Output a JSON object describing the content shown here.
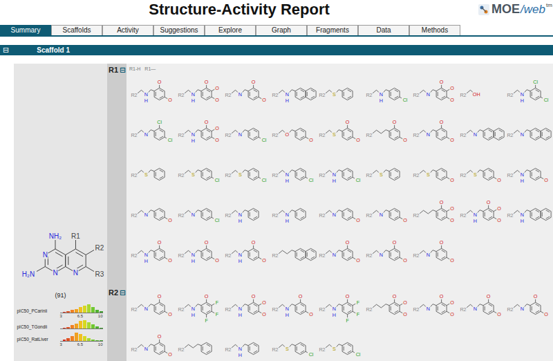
{
  "window": {
    "title": "Structure-Activity Report"
  },
  "logo": {
    "name": "MOE",
    "suffix": "/web",
    "tm": "tm"
  },
  "tabs": [
    {
      "label": "Summary",
      "selected": true
    },
    {
      "label": "Scaffolds",
      "selected": false
    },
    {
      "label": "Activity",
      "selected": false
    },
    {
      "label": "Suggestions",
      "selected": false
    },
    {
      "label": "Explore",
      "selected": false
    },
    {
      "label": "Graph",
      "selected": false
    },
    {
      "label": "Fragments",
      "selected": false
    },
    {
      "label": "Data",
      "selected": false
    },
    {
      "label": "Methods",
      "selected": false
    }
  ],
  "scaffold_bar": {
    "toggle": "⊟",
    "title": "Scaffold 1",
    "expanded": true
  },
  "scaffold": {
    "labels": {
      "c4": "NH₂",
      "r1": "R1",
      "r2": "R2",
      "n3": "N",
      "c2": "H₂N",
      "n1": "N",
      "n8": "N",
      "r3": "R3"
    },
    "count": "(91)"
  },
  "histograms": [
    {
      "label": "pIC50_PCarinii",
      "ticks": [
        "3",
        "6.5",
        "10"
      ],
      "bins": [
        {
          "level": 0.1,
          "color": "#d83020"
        },
        {
          "level": 0.15,
          "color": "#e05020"
        },
        {
          "level": 0.3,
          "color": "#f08020"
        },
        {
          "level": 0.45,
          "color": "#f0a020"
        },
        {
          "level": 0.65,
          "color": "#f0c020"
        },
        {
          "level": 0.85,
          "color": "#d8d820"
        },
        {
          "level": 1,
          "color": "#a8d830"
        },
        {
          "level": 0.7,
          "color": "#70c830"
        },
        {
          "level": 0.35,
          "color": "#50b030"
        },
        {
          "level": 0.15,
          "color": "#40a030"
        }
      ]
    },
    {
      "label": "pIC50_TGondii",
      "ticks": [],
      "bins": [
        {
          "level": 0.1,
          "color": "#d83020"
        },
        {
          "level": 0.2,
          "color": "#e05020"
        },
        {
          "level": 0.4,
          "color": "#f08020"
        },
        {
          "level": 0.6,
          "color": "#f0a020"
        },
        {
          "level": 0.9,
          "color": "#f0c020"
        },
        {
          "level": 1,
          "color": "#d8d820"
        },
        {
          "level": 0.75,
          "color": "#a8d830"
        },
        {
          "level": 0.5,
          "color": "#70c830"
        },
        {
          "level": 0.25,
          "color": "#50b030"
        },
        {
          "level": 0.1,
          "color": "#40a030"
        }
      ]
    },
    {
      "label": "pIC50_RatLiver",
      "ticks": [
        "3",
        "6.5",
        "10"
      ],
      "bins": [
        {
          "level": 0.15,
          "color": "#d83020"
        },
        {
          "level": 0.35,
          "color": "#e05020"
        },
        {
          "level": 0.6,
          "color": "#f08020"
        },
        {
          "level": 1,
          "color": "#f0a020"
        },
        {
          "level": 0.8,
          "color": "#f0c020"
        },
        {
          "level": 0.55,
          "color": "#d8d820"
        },
        {
          "level": 0.35,
          "color": "#a8d830"
        },
        {
          "level": 0.2,
          "color": "#70c830"
        },
        {
          "level": 0.1,
          "color": "#50b030"
        },
        {
          "level": 0.05,
          "color": "#40a030"
        }
      ]
    }
  ],
  "element_colors": {
    "R2": "#8a8a8a",
    "N": "#2a2adc",
    "H": "#2a2adc",
    "O": "#d02020",
    "OH": "#d02020",
    "S": "#b09a00",
    "Cl": "#1f9f1f",
    "F": "#1f9f1f"
  },
  "sections": [
    {
      "label": "R1",
      "toggle": "⊟",
      "expanded": true,
      "header": [
        "R1-H",
        "R1—"
      ],
      "attach_label": "R2",
      "fragments": [
        {
          "link": [
            "N",
            "H"
          ],
          "ring": "benzene",
          "subs": [
            "O",
            "O"
          ]
        },
        {
          "link": [
            "N",
            "H"
          ],
          "ring": "benzene",
          "subs": [
            "O",
            "O",
            "O"
          ]
        },
        {
          "link": [
            "N"
          ],
          "ring": "benzene",
          "subs": [
            "O",
            "O"
          ]
        },
        {
          "link": [
            "N",
            "H"
          ],
          "ring": "fused",
          "subs": []
        },
        {
          "link": [
            "S"
          ],
          "ring": "benzene",
          "subs": []
        },
        {
          "link": [
            "N",
            "H"
          ],
          "ring": "benzene",
          "subs": [
            "Cl"
          ]
        },
        {
          "link": [
            "N"
          ],
          "ring": "benzene",
          "subs": [
            "O",
            "O",
            "O"
          ]
        },
        {
          "link": [
            "OH"
          ],
          "ring": "none",
          "subs": []
        },
        {
          "link": [
            "N",
            "H"
          ],
          "ring": "benzene",
          "subs": [
            "Cl",
            "Cl"
          ]
        },
        {
          "link": [
            "N"
          ],
          "ring": "benzene",
          "subs": [
            "Cl",
            "Cl"
          ]
        },
        {
          "link": [
            "N",
            "H"
          ],
          "ring": "benzene",
          "subs": [
            "O",
            "O",
            "O"
          ]
        },
        {
          "link": [
            "N"
          ],
          "ring": "benzene",
          "subs": [
            "Cl"
          ]
        },
        {
          "link": [
            "O"
          ],
          "ring": "benzene",
          "subs": [
            "O"
          ]
        },
        {
          "link": [
            "S"
          ],
          "ring": "benzene",
          "subs": [
            "O",
            "O"
          ]
        },
        {
          "link": [],
          "ring": "benzene",
          "subs": [
            "O",
            "O"
          ]
        },
        {
          "link": [
            "N"
          ],
          "ring": "benzene",
          "subs": [
            "O",
            "O"
          ]
        },
        {
          "link": [
            "N"
          ],
          "ring": "fused",
          "subs": []
        },
        {
          "link": [
            "N"
          ],
          "ring": "fused",
          "subs": []
        },
        {
          "link": [
            "S"
          ],
          "ring": "benzene",
          "subs": []
        },
        {
          "link": [
            "S"
          ],
          "ring": "benzene",
          "subs": [
            "Cl"
          ]
        },
        {
          "link": [
            "S"
          ],
          "ring": "benzene",
          "subs": [
            "Cl"
          ]
        },
        {
          "link": [
            "N",
            "H"
          ],
          "ring": "benzene",
          "subs": [
            "Cl"
          ]
        },
        {
          "link": [
            "N",
            "H"
          ],
          "ring": "benzene",
          "subs": [
            "Cl"
          ]
        },
        {
          "link": [
            "S"
          ],
          "ring": "benzene",
          "subs": []
        },
        {
          "link": [
            "S"
          ],
          "ring": "benzene",
          "subs": [
            "O"
          ]
        },
        {
          "link": [
            "S"
          ],
          "ring": "benzene",
          "subs": [
            "O"
          ]
        },
        {
          "link": [
            "N",
            "H"
          ],
          "ring": "benzene",
          "subs": [
            "O"
          ]
        },
        {
          "link": [
            "N"
          ],
          "ring": "benzene",
          "subs": [
            "O"
          ]
        },
        {
          "link": [
            "N"
          ],
          "ring": "benzene",
          "subs": [
            "Cl"
          ]
        },
        {
          "link": [
            "N",
            "H"
          ],
          "ring": "benzene",
          "subs": []
        },
        {
          "link": [
            "N",
            "H"
          ],
          "ring": "benzene",
          "subs": []
        },
        {
          "link": [
            "N"
          ],
          "ring": "benzene",
          "subs": [
            "O"
          ]
        },
        {
          "link": [
            "N"
          ],
          "ring": "benzene",
          "subs": [
            "O"
          ]
        },
        {
          "link": [],
          "ring": "benzene",
          "subs": [
            "O",
            "O",
            "O"
          ]
        },
        {
          "link": [
            "N",
            "H"
          ],
          "ring": "benzene",
          "subs": [
            "O",
            "O",
            "O"
          ]
        },
        {
          "link": [
            "N",
            "H"
          ],
          "ring": "fused",
          "subs": []
        },
        {
          "link": [
            "N",
            "H"
          ],
          "ring": "benzene",
          "subs": [
            "O",
            "O"
          ]
        },
        {
          "link": [
            "N",
            "H"
          ],
          "ring": "benzene",
          "subs": [
            "O",
            "O"
          ]
        },
        {
          "link": [
            "N",
            "H"
          ],
          "ring": "benzene",
          "subs": [
            "O",
            "O"
          ]
        },
        {
          "link": [],
          "ring": "fused",
          "subs": []
        },
        {
          "link": [
            "N"
          ],
          "ring": "benzene",
          "subs": [
            "O",
            "O"
          ]
        },
        {
          "link": [
            "N"
          ],
          "ring": "benzene",
          "subs": [
            "O",
            "O"
          ]
        },
        {
          "link": [
            "N"
          ],
          "ring": "benzene",
          "subs": [
            "O",
            "O"
          ]
        }
      ]
    },
    {
      "label": "R2",
      "toggle": "⊟",
      "expanded": true,
      "header": [],
      "attach_label": "R2",
      "fragments": [
        {
          "link": [
            "N"
          ],
          "ring": "benzene",
          "subs": [
            "O",
            "O"
          ]
        },
        {
          "link": [
            "N",
            "H"
          ],
          "ring": "benzene",
          "subs": [
            "O",
            "F",
            "F",
            "F"
          ]
        },
        {
          "link": [
            "N",
            "H"
          ],
          "ring": "benzene",
          "subs": [
            "O",
            "O",
            "O"
          ]
        },
        {
          "link": [
            "N",
            "H"
          ],
          "ring": "benzene",
          "subs": [
            "O",
            "O"
          ]
        },
        {
          "link": [
            "N",
            "H"
          ],
          "ring": "benzene",
          "subs": [
            "O",
            "F",
            "F",
            "F"
          ]
        },
        {
          "link": [],
          "ring": "benzene",
          "subs": [
            "O",
            "O",
            "O"
          ]
        },
        {
          "link": [
            "N"
          ],
          "ring": "benzene",
          "subs": [
            "O",
            "O",
            "O"
          ]
        },
        {
          "link": [
            "N"
          ],
          "ring": "benzene",
          "subs": [
            "O",
            "O"
          ]
        },
        {
          "link": [
            "N"
          ],
          "ring": "benzene",
          "subs": [
            "O",
            "O"
          ]
        },
        {
          "link": [
            "N"
          ],
          "ring": "benzene",
          "subs": [
            "O",
            "O"
          ]
        },
        {
          "link": [],
          "ring": "benzene",
          "subs": []
        },
        {
          "link": [
            "N",
            "H"
          ],
          "ring": "benzene",
          "subs": []
        },
        {
          "link": [
            "S"
          ],
          "ring": "benzene",
          "subs": [
            "Cl"
          ]
        },
        {
          "link": [
            "S"
          ],
          "ring": "benzene",
          "subs": [
            "Cl"
          ]
        }
      ]
    }
  ]
}
